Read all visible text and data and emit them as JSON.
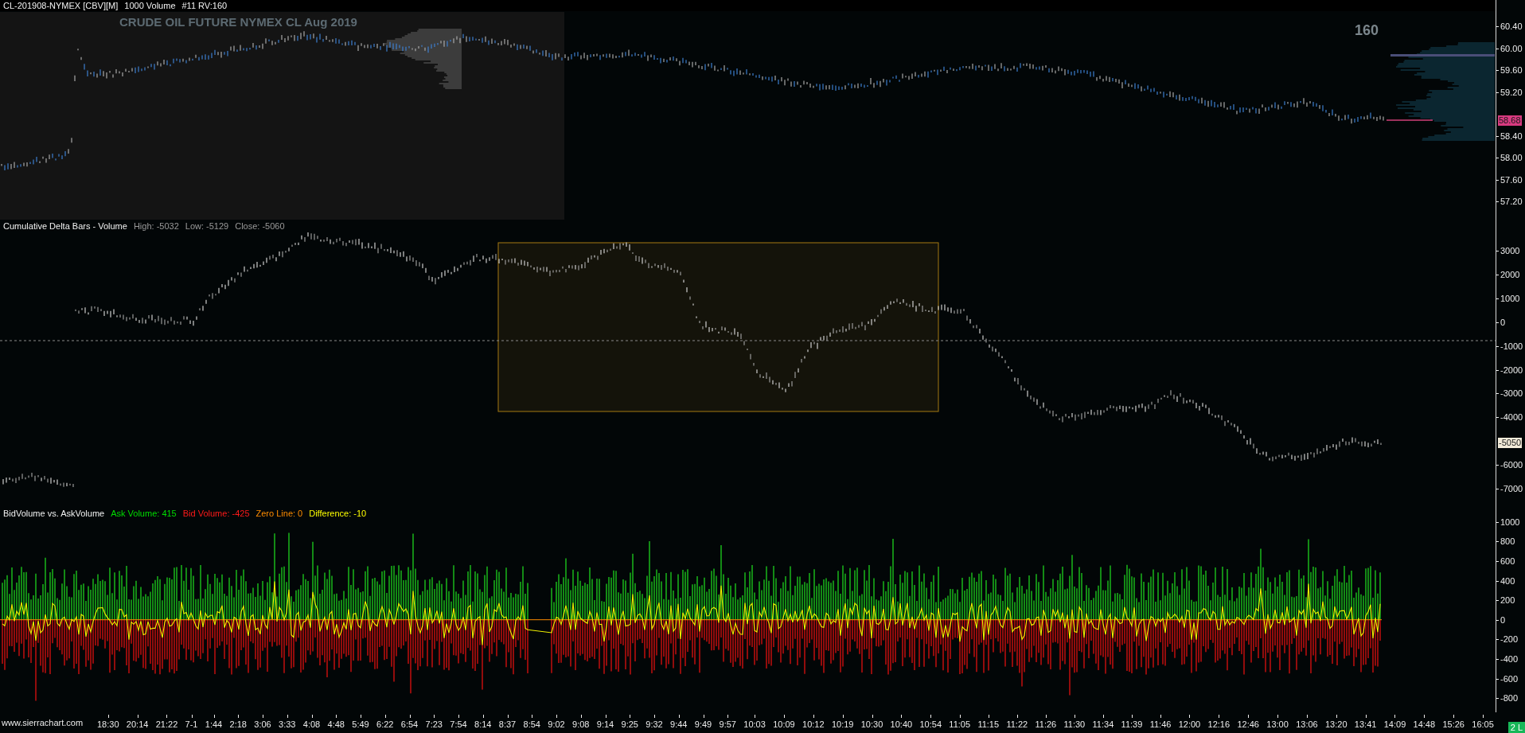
{
  "chart_header": {
    "symbol": "CL-201908-NYMEX [CBV][M]",
    "bar_period": "1000 Volume",
    "chart_number": "#11 RV:160"
  },
  "price_panel": {
    "title": "CRUDE OIL FUTURE NYMEX CL Aug 2019",
    "bar_counter": "160",
    "axis_labels": [
      "60.40",
      "60.00",
      "59.60",
      "59.20",
      "58.40",
      "58.00",
      "57.60",
      "57.20"
    ],
    "last_price": "58.68"
  },
  "delta_panel": {
    "name": "Cumulative Delta Bars - Volume",
    "values": [
      "High: -5032",
      "Low: -5129",
      "Close: -5060"
    ],
    "axis_labels": [
      "3000",
      "2000",
      "1000",
      "0",
      "-1000",
      "-2000",
      "-3000",
      "-4000",
      "-6000",
      "-7000"
    ],
    "last_value": "-5050"
  },
  "volume_panel": {
    "name": "BidVolume vs. AskVolume",
    "values": [
      {
        "label": "Ask Volume: 415",
        "color": "#00dd00"
      },
      {
        "label": "Bid Volume: -425",
        "color": "#ff1a1a"
      },
      {
        "label": "Zero Line: 0",
        "color": "#ff8c00"
      },
      {
        "label": "Difference: -10",
        "color": "#ffff00"
      }
    ],
    "axis_labels": [
      "1000",
      "800",
      "600",
      "400",
      "200",
      "0",
      "-200",
      "-400",
      "-600",
      "-800"
    ]
  },
  "time_axis": {
    "website": "www.sierrachart.com",
    "labels": [
      "18:30",
      "20:14",
      "21:22",
      "7-1",
      "1:44",
      "2:18",
      "3:06",
      "3:33",
      "4:08",
      "4:48",
      "5:49",
      "6:22",
      "6:54",
      "7:23",
      "7:54",
      "8:14",
      "8:37",
      "8:54",
      "9:02",
      "9:08",
      "9:14",
      "9:25",
      "9:32",
      "9:44",
      "9:49",
      "9:57",
      "10:03",
      "10:09",
      "10:12",
      "10:19",
      "10:30",
      "10:40",
      "10:54",
      "11:05",
      "11:15",
      "11:22",
      "11:26",
      "11:30",
      "11:34",
      "11:39",
      "11:46",
      "12:00",
      "12:16",
      "12:46",
      "13:00",
      "13:06",
      "13:20",
      "13:41",
      "14:09",
      "14:48",
      "15:26",
      "16:05"
    ]
  },
  "status_badge": "2 L"
}
